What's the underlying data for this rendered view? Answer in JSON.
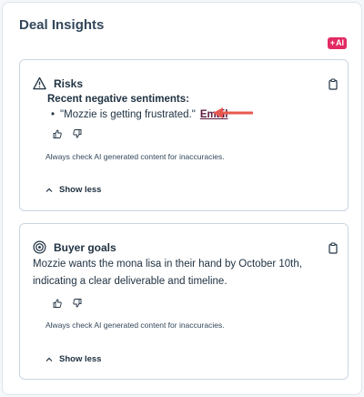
{
  "panel": {
    "title": "Deal Insights",
    "ai_badge": "AI"
  },
  "risks": {
    "title": "Risks",
    "subtitle": "Recent negative sentiments:",
    "items": [
      {
        "quote": "\"Mozzie is getting frustrated.\"",
        "link": "Email"
      }
    ],
    "disclaimer": "Always check AI generated content for inaccuracies.",
    "toggle": "Show less"
  },
  "goals": {
    "title": "Buyer goals",
    "text": "Mozzie wants the mona lisa in their hand by October 10th, indicating a clear deliverable and timeline.",
    "disclaimer": "Always check AI generated content for inaccuracies.",
    "toggle": "Show less"
  },
  "colors": {
    "accent": "#e22b63",
    "arrow": "#e8584f",
    "link": "#5c1a3f"
  }
}
